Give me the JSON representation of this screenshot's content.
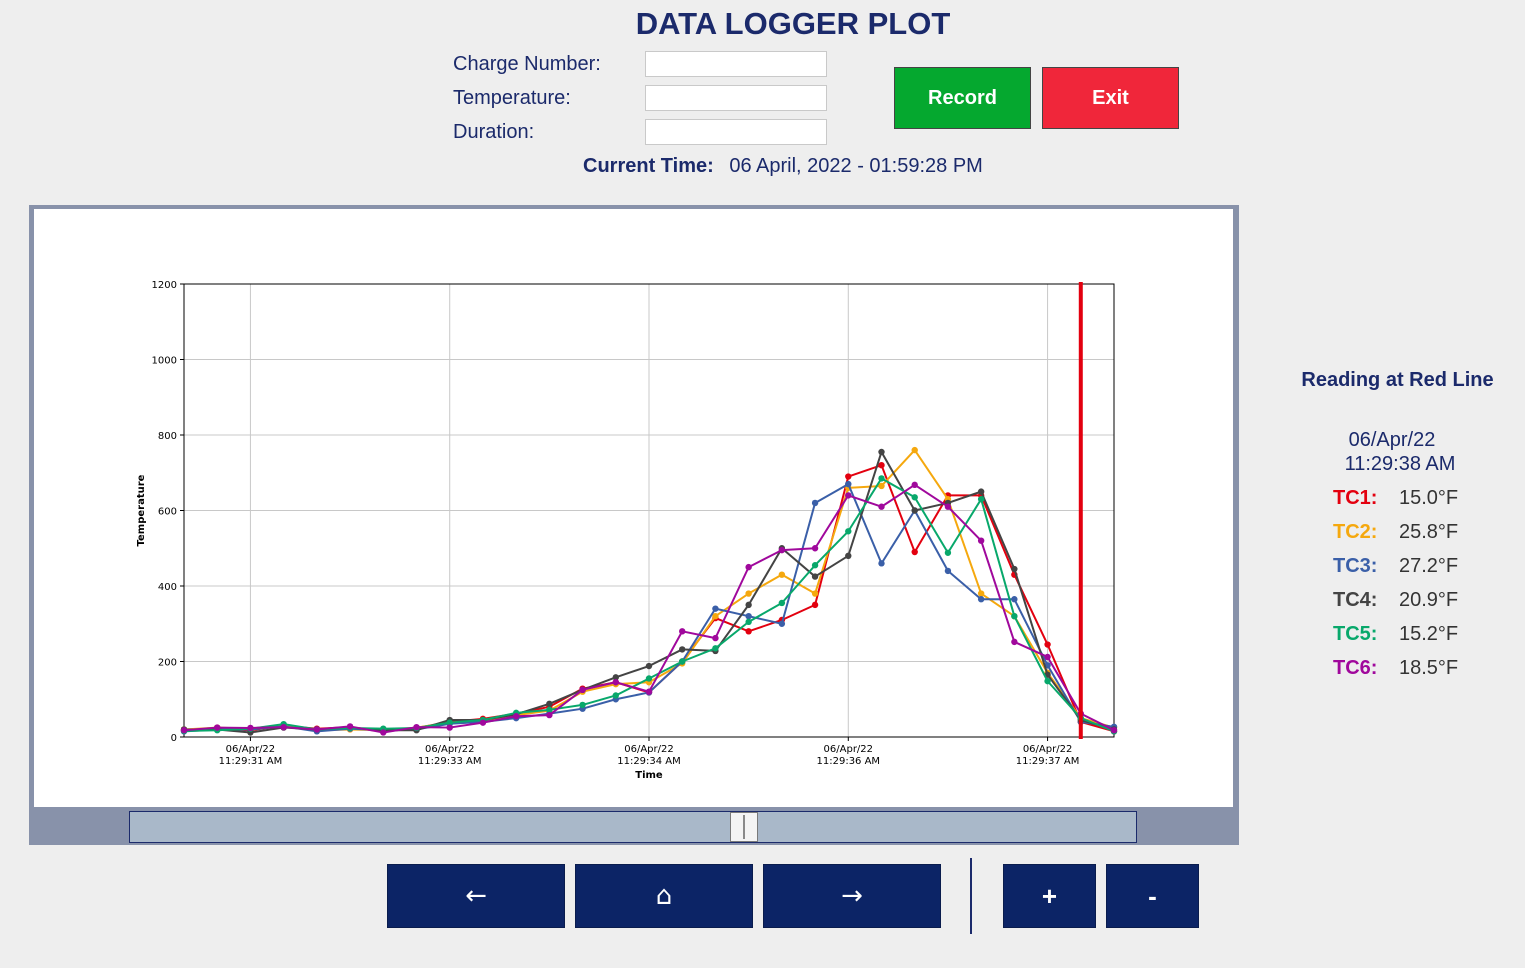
{
  "app": {
    "title": "DATA LOGGER PLOT"
  },
  "form": {
    "charge_label": "Charge Number:",
    "temperature_label": "Temperature:",
    "duration_label": "Duration:",
    "charge_value": "",
    "temperature_value": "",
    "duration_value": ""
  },
  "buttons": {
    "record": "Record",
    "exit": "Exit"
  },
  "current_time": {
    "label": "Current Time:",
    "value": "06 April, 2022 - 01:59:28 PM"
  },
  "reading": {
    "title": "Reading at Red Line",
    "date": "06/Apr/22",
    "time": "11:29:38 AM",
    "items": [
      {
        "name": "TC1:",
        "value": "15.0°F",
        "color": "#e3000f"
      },
      {
        "name": "TC2:",
        "value": "25.8°F",
        "color": "#f5a80e"
      },
      {
        "name": "TC3:",
        "value": "27.2°F",
        "color": "#3a5fa8"
      },
      {
        "name": "TC4:",
        "value": "20.9°F",
        "color": "#444444"
      },
      {
        "name": "TC5:",
        "value": "15.2°F",
        "color": "#08a86b"
      },
      {
        "name": "TC6:",
        "value": "18.5°F",
        "color": "#a0089c"
      }
    ]
  },
  "slider": {
    "value": 0.61
  },
  "nav": {
    "back": "←",
    "home": "⌂",
    "forward": "→",
    "zoom_in": "+",
    "zoom_out": "-"
  },
  "chart_data": {
    "type": "line",
    "xlabel": "Time",
    "ylabel": "Temperature",
    "ylim": [
      0,
      1200
    ],
    "yticks": [
      0,
      200,
      400,
      600,
      800,
      1000,
      1200
    ],
    "grid": true,
    "x_step_seconds": 0.167,
    "x_start": "06/Apr/22 11:29:30.6 AM",
    "xticks": [
      {
        "x": 2,
        "date": "06/Apr/22",
        "time": "11:29:31 AM"
      },
      {
        "x": 8,
        "date": "06/Apr/22",
        "time": "11:29:33 AM"
      },
      {
        "x": 14,
        "date": "06/Apr/22",
        "time": "11:29:34 AM"
      },
      {
        "x": 20,
        "date": "06/Apr/22",
        "time": "11:29:36 AM"
      },
      {
        "x": 26,
        "date": "06/Apr/22",
        "time": "11:29:37 AM"
      }
    ],
    "x_count": 28,
    "red_line_x": 27,
    "series": [
      {
        "name": "TC1",
        "color": "#e3000f",
        "values": [
          18,
          22,
          18,
          30,
          22,
          26,
          14,
          24,
          40,
          48,
          62,
          80,
          128,
          145,
          118,
          200,
          315,
          280,
          310,
          350,
          690,
          720,
          490,
          640,
          640,
          430,
          245,
          40,
          15
        ]
      },
      {
        "name": "TC2",
        "color": "#f5a80e",
        "values": [
          20,
          25,
          22,
          32,
          18,
          20,
          18,
          25,
          38,
          42,
          58,
          70,
          120,
          140,
          145,
          195,
          320,
          380,
          430,
          380,
          660,
          665,
          760,
          630,
          380,
          320,
          170,
          50,
          25
        ]
      },
      {
        "name": "TC3",
        "color": "#3a5fa8",
        "values": [
          15,
          20,
          20,
          28,
          15,
          22,
          18,
          20,
          35,
          40,
          50,
          62,
          75,
          100,
          118,
          200,
          340,
          320,
          300,
          620,
          670,
          460,
          600,
          440,
          365,
          365,
          190,
          40,
          27
        ]
      },
      {
        "name": "TC4",
        "color": "#444444",
        "values": [
          20,
          20,
          12,
          25,
          20,
          25,
          18,
          18,
          45,
          45,
          60,
          88,
          125,
          158,
          188,
          232,
          228,
          350,
          500,
          425,
          480,
          755,
          600,
          620,
          650,
          445,
          165,
          45,
          20
        ]
      },
      {
        "name": "TC5",
        "color": "#08a86b",
        "values": [
          16,
          18,
          22,
          34,
          20,
          24,
          22,
          24,
          38,
          45,
          64,
          72,
          85,
          110,
          155,
          200,
          235,
          305,
          355,
          455,
          545,
          685,
          635,
          488,
          630,
          320,
          148,
          50,
          15
        ]
      },
      {
        "name": "TC6",
        "color": "#a0089c",
        "values": [
          18,
          25,
          24,
          26,
          20,
          28,
          12,
          26,
          25,
          38,
          55,
          58,
          125,
          145,
          120,
          280,
          262,
          450,
          495,
          500,
          640,
          610,
          668,
          610,
          520,
          252,
          212,
          62,
          18
        ]
      }
    ]
  }
}
